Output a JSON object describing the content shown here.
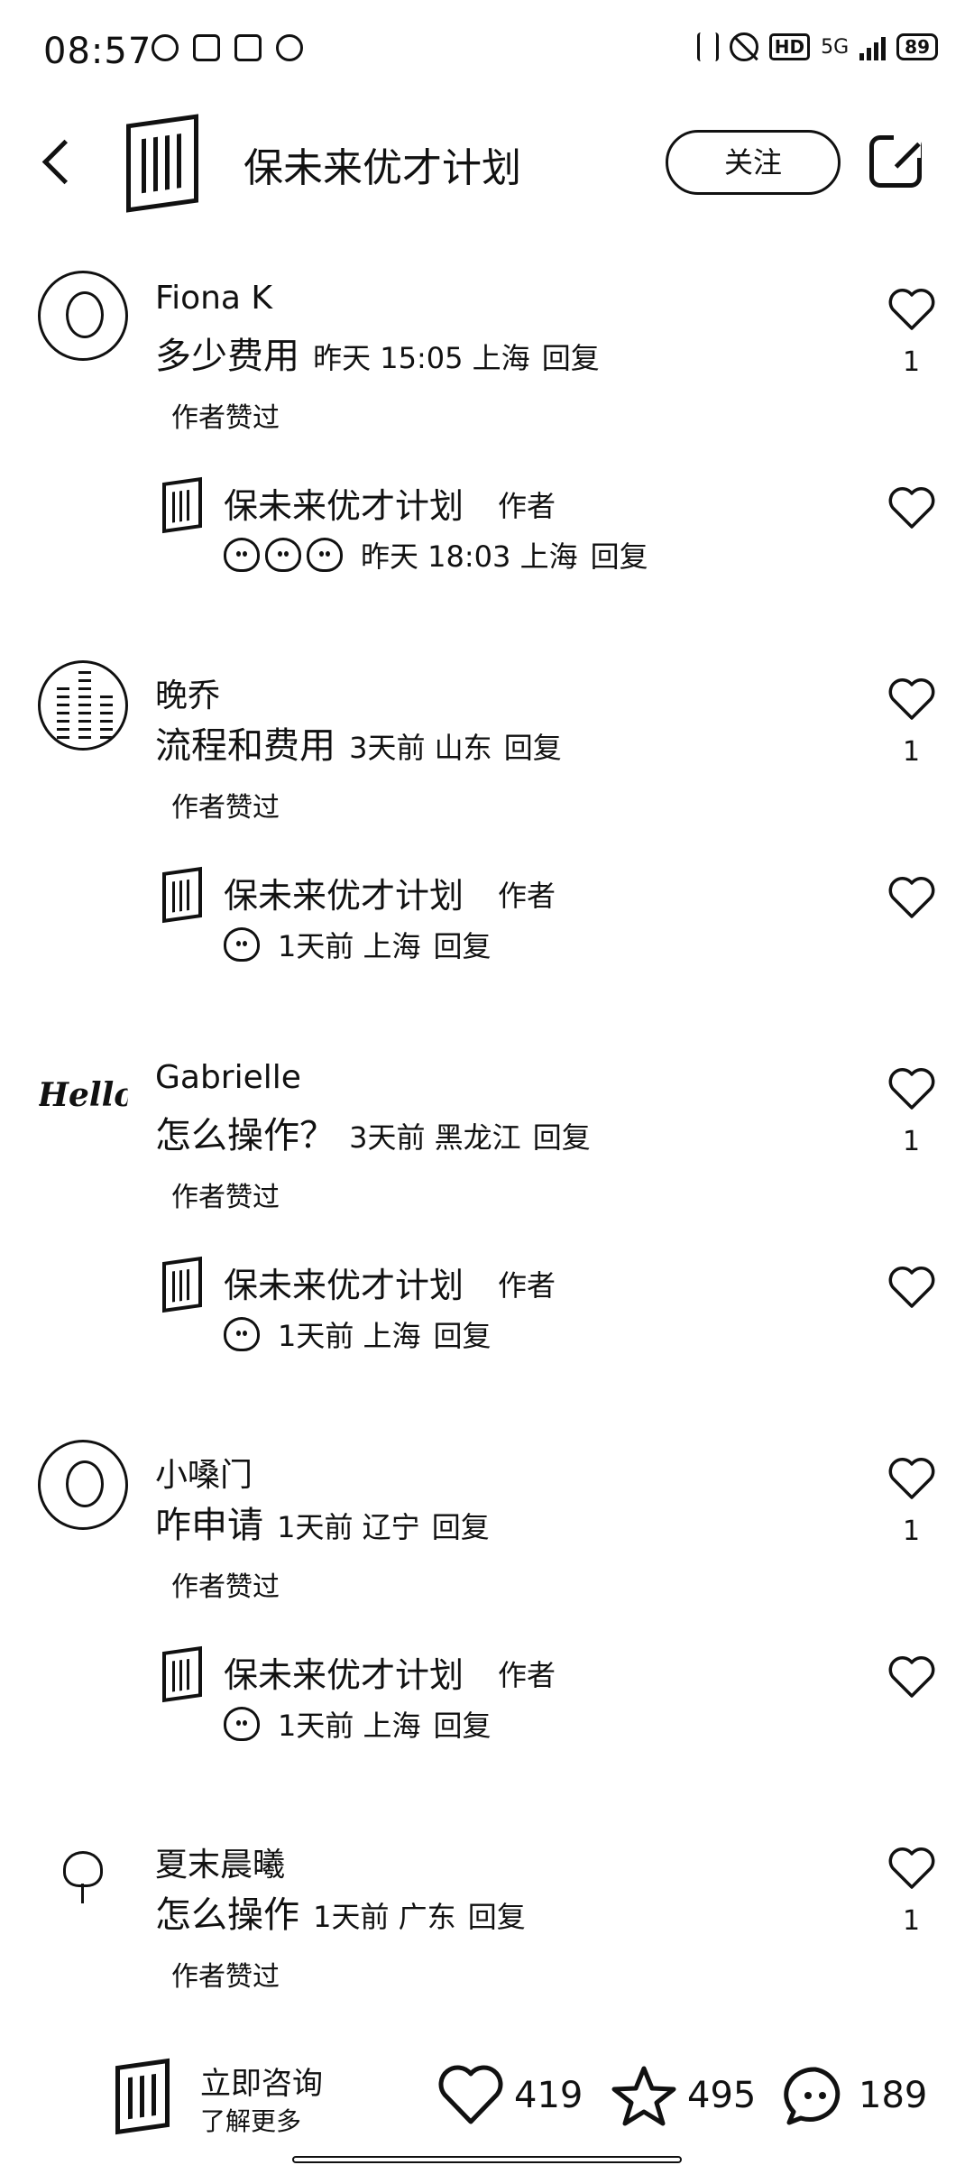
{
  "status_bar": {
    "time": "08:57",
    "network": "5G",
    "battery": "89"
  },
  "header": {
    "title": "保未来优才计划",
    "follow_label": "关注"
  },
  "comments": [
    {
      "name": "Fiona K",
      "text": "多少费用",
      "meta": "昨天 15:05 上海",
      "reply_label": "回复",
      "liked_by_author": "作者赞过",
      "likes": "1",
      "author_reply": {
        "name": "保未来优才计划",
        "tag": "作者",
        "emojis": 3,
        "meta": "昨天 18:03 上海",
        "reply_label": "回复"
      }
    },
    {
      "name": "晚乔",
      "text": "流程和费用",
      "meta": "3天前  山东",
      "reply_label": "回复",
      "liked_by_author": "作者赞过",
      "likes": "1",
      "author_reply": {
        "name": "保未来优才计划",
        "tag": "作者",
        "emojis": 1,
        "meta": "1天前  上海",
        "reply_label": "回复"
      }
    },
    {
      "name": "Gabrielle",
      "text": "怎么操作？",
      "meta": "3天前  黑龙江",
      "reply_label": "回复",
      "liked_by_author": "作者赞过",
      "likes": "1",
      "author_reply": {
        "name": "保未来优才计划",
        "tag": "作者",
        "emojis": 1,
        "meta": "1天前  上海",
        "reply_label": "回复"
      }
    },
    {
      "name": "小嗓门",
      "text": "咋申请",
      "meta": "1天前  辽宁",
      "reply_label": "回复",
      "liked_by_author": "作者赞过",
      "likes": "1",
      "author_reply": {
        "name": "保未来优才计划",
        "tag": "作者",
        "emojis": 1,
        "meta": "1天前  上海",
        "reply_label": "回复"
      }
    },
    {
      "name": "夏末晨曦",
      "text": "怎么操作",
      "meta": "1天前  广东",
      "reply_label": "回复",
      "liked_by_author": "作者赞过",
      "likes": "1"
    }
  ],
  "avatar_text": {
    "hello": "Hello"
  },
  "bottom_bar": {
    "consult_label": "立即咨询",
    "more_label": "了解更多",
    "likes": "419",
    "favorites": "495",
    "comments": "189"
  }
}
